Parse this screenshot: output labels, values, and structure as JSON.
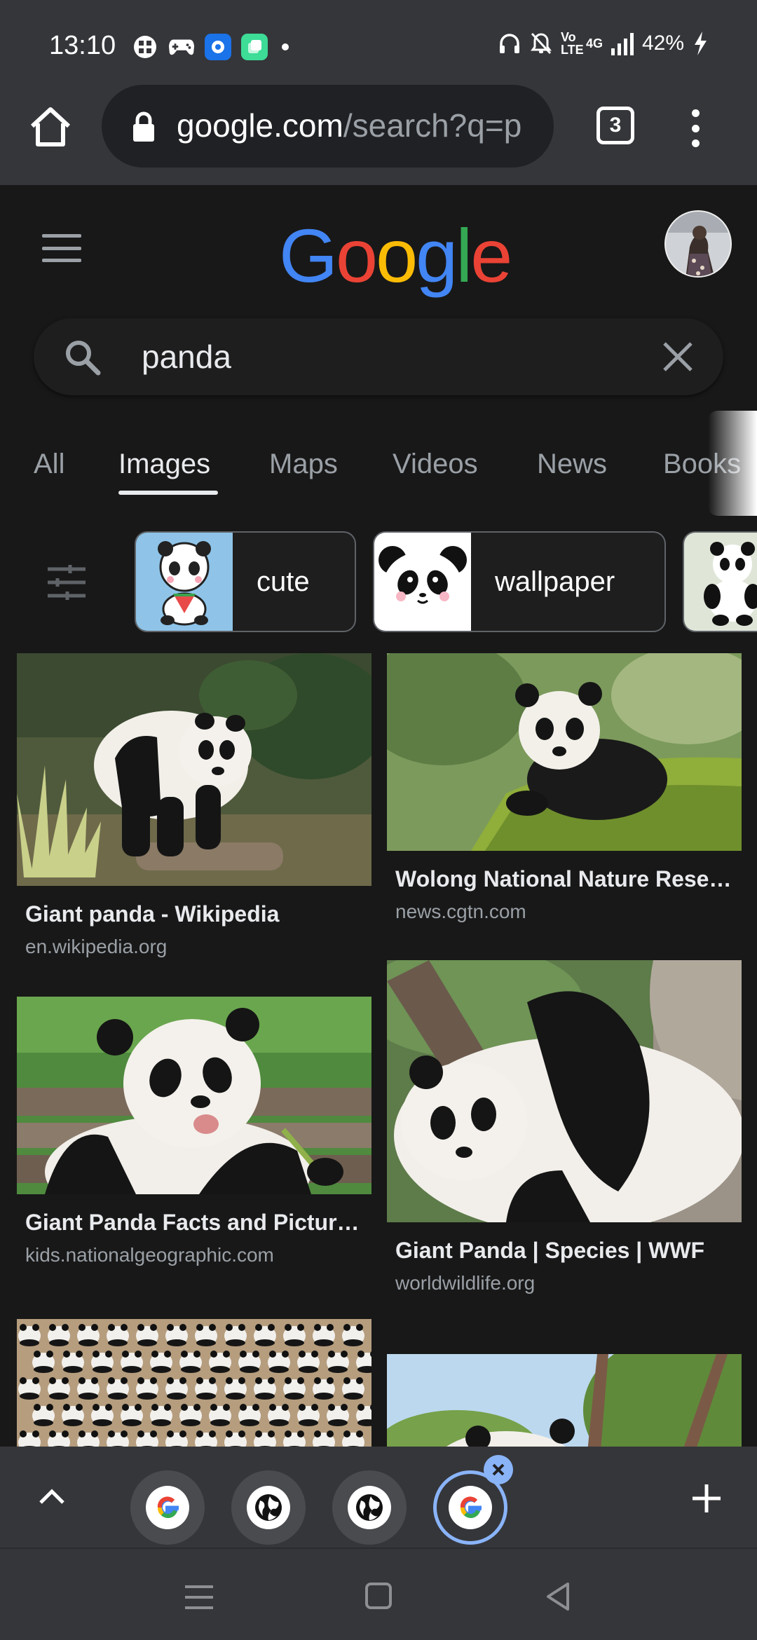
{
  "status_bar": {
    "time": "13:10",
    "network": "4G",
    "volte": "Vo LTE",
    "battery": "42%"
  },
  "toolbar": {
    "url_host": "google.com",
    "url_path": "/search?q=p",
    "tab_count": "3"
  },
  "page": {
    "logo_letters": [
      "G",
      "o",
      "o",
      "g",
      "l",
      "e"
    ],
    "logo_colors": [
      "#4285f4",
      "#ea4335",
      "#fbbc05",
      "#4285f4",
      "#34a853",
      "#ea4335"
    ],
    "search_query": "panda",
    "tabs": [
      "All",
      "Images",
      "Maps",
      "Videos",
      "News",
      "Books"
    ],
    "active_tab": "Images",
    "chips": [
      {
        "label": "cute"
      },
      {
        "label": "wallpaper"
      }
    ],
    "results": [
      {
        "title": "Giant panda - Wikipedia",
        "source": "en.wikipedia.org"
      },
      {
        "title": "Wolong National Nature Rese…",
        "source": "news.cgtn.com"
      },
      {
        "title": "Giant Panda Facts and Pictur…",
        "source": "kids.nationalgeographic.com"
      },
      {
        "title": "Giant Panda | Species | WWF",
        "source": "worldwildlife.org"
      }
    ]
  },
  "tab_strip": {
    "tabs": [
      "google-tab",
      "globe-tab",
      "globe-tab",
      "google-tab-selected"
    ]
  },
  "colors": {
    "toolbar_bg": "#35363a",
    "page_bg": "#181818",
    "accent": "#8ab4f8"
  }
}
